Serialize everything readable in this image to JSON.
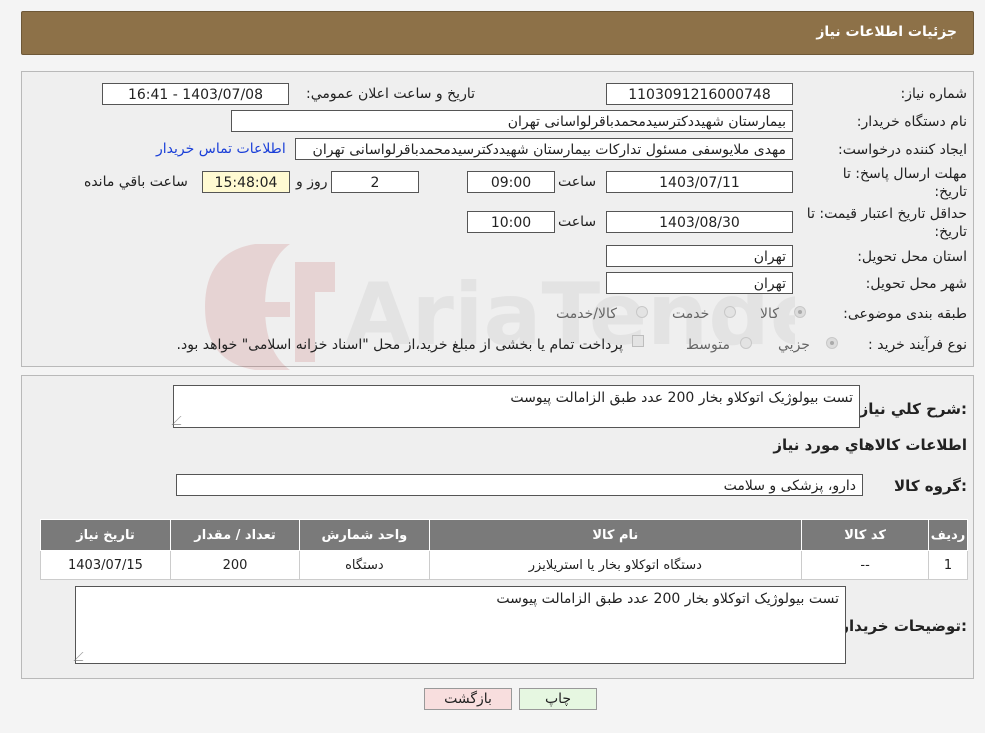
{
  "header": {
    "title": "جزئیات اطلاعات نیاز"
  },
  "fields": {
    "need_number_label": "شماره نیاز:",
    "need_number": "1103091216000748",
    "announce_label": "تاریخ و ساعت اعلان عمومي:",
    "announce_value": "1403/07/08 - 16:41",
    "buyer_label": "نام دستگاه خریدار:",
    "buyer_value": "بیمارستان شهیددکترسیدمحمدباقرلواسانی تهران",
    "creator_label": "ایجاد کننده درخواست:",
    "creator_value": "مهدی ملایوسفی مسئول تدارکات بیمارستان شهیددکترسیدمحمدباقرلواسانی تهران",
    "contact_link": "اطلاعات تماس خریدار",
    "deadline_label_1": "مهلت ارسال پاسخ: تا",
    "deadline_label_2": "تاریخ:",
    "deadline_date": "1403/07/11",
    "time_label": "ساعت",
    "deadline_time": "09:00",
    "days_value": "2",
    "days_label": "روز و",
    "remaining_time": "15:48:04",
    "remaining_label": "ساعت باقي مانده",
    "validity_label_1": "حداقل تاریخ اعتبار قیمت: تا",
    "validity_label_2": "تاریخ:",
    "validity_date": "1403/08/30",
    "validity_time": "10:00",
    "province_label": "استان محل تحویل:",
    "province_value": "تهران",
    "city_label": "شهر محل تحویل:",
    "city_value": "تهران",
    "category_label": "طبقه بندی موضوعی:",
    "category_options": [
      "کالا",
      "خدمت",
      "کالا/خدمت"
    ],
    "process_label": "نوع فرآیند خرید :",
    "process_options": [
      "جزیي",
      "متوسط"
    ],
    "process_note": "پرداخت تمام یا بخشی از مبلغ خرید،از محل \"اسناد خزانه اسلامی\" خواهد بود."
  },
  "summary": {
    "label": "شرح کلي نیاز:",
    "value": "تست بیولوژیک اتوکلاو بخار 200 عدد طبق الزامالت پیوست",
    "goods_title": "اطلاعات کالاهاي مورد نیاز",
    "group_label": "گروه کالا:",
    "group_value": "دارو، پزشکی و سلامت"
  },
  "table": {
    "headers": [
      "ردیف",
      "کد کالا",
      "نام کالا",
      "واحد شمارش",
      "تعداد / مقدار",
      "تاریخ نیاز"
    ],
    "rows": [
      [
        "1",
        "--",
        "دستگاه اتوکلاو بخار یا استریلایزر",
        "دستگاه",
        "200",
        "1403/07/15"
      ]
    ]
  },
  "buyer_notes": {
    "label": "توضیحات خریدار:",
    "value": "تست بیولوژیک اتوکلاو بخار 200 عدد طبق الزامالت پیوست"
  },
  "buttons": {
    "print": "چاپ",
    "back": "بازگشت"
  },
  "watermark": {
    "text": "AriaTender.neT"
  },
  "colors": {
    "header": "#8d7148",
    "table_header": "#7a7a7a",
    "link": "#1a3fd8",
    "back_button": "#f8dede",
    "print_button": "#e6f7e1"
  }
}
